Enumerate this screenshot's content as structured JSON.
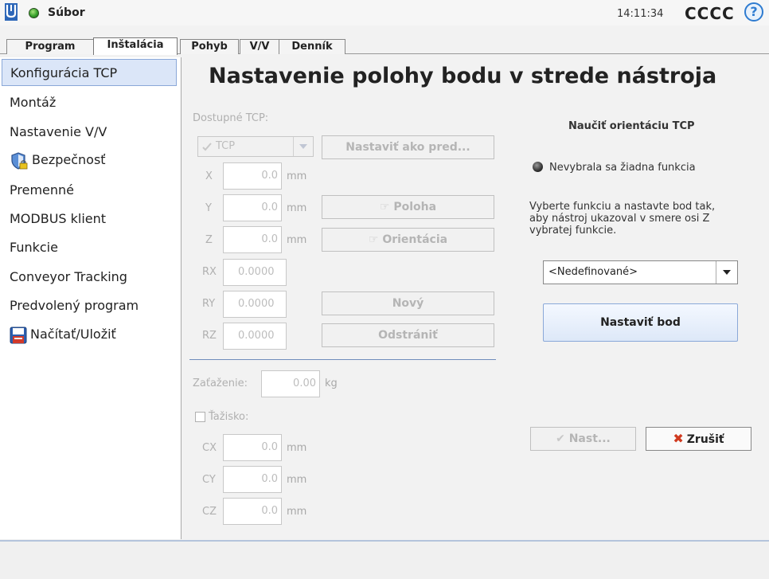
{
  "header": {
    "file_menu": "Súbor",
    "clock": "14:11:34",
    "robot_name": "CCCC",
    "help_glyph": "?"
  },
  "tabs": [
    {
      "label": "Program",
      "active": false
    },
    {
      "label": "Inštalácia",
      "active": true
    },
    {
      "label": "Pohyb",
      "active": false
    },
    {
      "label": "V/V",
      "active": false
    },
    {
      "label": "Denník",
      "active": false
    }
  ],
  "sidebar": {
    "items": [
      {
        "label": "Konfigurácia TCP",
        "active": true
      },
      {
        "label": "Montáž"
      },
      {
        "label": "Nastavenie V/V"
      },
      {
        "label": "Bezpečnosť",
        "icon": "shield-lock-icon"
      },
      {
        "label": "Premenné"
      },
      {
        "label": "MODBUS klient"
      },
      {
        "label": "Funkcie"
      },
      {
        "label": "Conveyor Tracking"
      },
      {
        "label": "Predvolený program"
      },
      {
        "label": "Načítať/Uložiť",
        "icon": "floppy-disk-icon"
      }
    ]
  },
  "main": {
    "title": "Nastavenie polohy bodu v strede nástroja",
    "available_tcp_label": "Dostupné TCP:",
    "tcp_select": "TCP",
    "set_default_button": "Nastaviť ako pred...",
    "fields": {
      "x": {
        "label": "X",
        "value": "0.0",
        "unit": "mm"
      },
      "y": {
        "label": "Y",
        "value": "0.0",
        "unit": "mm"
      },
      "z": {
        "label": "Z",
        "value": "0.0",
        "unit": "mm"
      },
      "rx": {
        "label": "RX",
        "value": "0.0000"
      },
      "ry": {
        "label": "RY",
        "value": "0.0000"
      },
      "rz": {
        "label": "RZ",
        "value": "0.0000"
      }
    },
    "position_button": "Poloha",
    "orientation_button": "Orientácia",
    "new_button": "Nový",
    "remove_button": "Odstrániť",
    "payload": {
      "label": "Zaťaženie:",
      "value": "0.00",
      "unit": "kg"
    },
    "cog": {
      "label": "Ťažisko:",
      "checked": false,
      "cx": {
        "label": "CX",
        "value": "0.0",
        "unit": "mm"
      },
      "cy": {
        "label": "CY",
        "value": "0.0",
        "unit": "mm"
      },
      "cz": {
        "label": "CZ",
        "value": "0.0",
        "unit": "mm"
      }
    }
  },
  "teach": {
    "title": "Naučiť orientáciu TCP",
    "status": "Nevybrala sa žiadna funkcia",
    "help_line1": "Vyberte funkciu a nastavte bod tak,",
    "help_line2": "aby nástroj ukazoval v smere osi Z",
    "help_line3": "vybratej funkcie.",
    "feature_select": "<Nedefinované>",
    "set_point_button": "Nastaviť bod",
    "apply_button": "Nast...",
    "cancel_button": "Zrušiť"
  },
  "colors": {
    "accent": "#2e7bd0",
    "active_nav": "#dbe6f8",
    "cancel_x": "#d03a1f",
    "status_ok": "#35a02a"
  }
}
